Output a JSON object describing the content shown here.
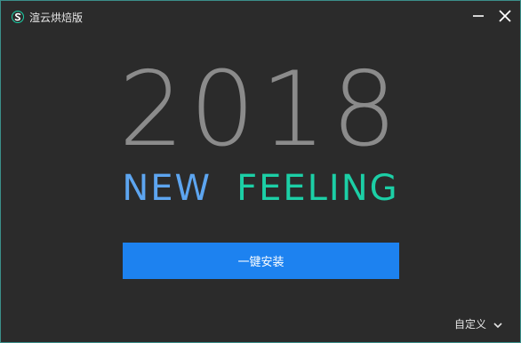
{
  "window": {
    "title": "渲云烘焙版",
    "logo_icon": "s-logo-icon",
    "minimize_icon": "minimize-icon",
    "close_icon": "close-icon",
    "border_color": "#3c8f8a"
  },
  "hero": {
    "year": "2018",
    "tagline_new": "NEW",
    "tagline_feeling": "FEELING",
    "year_color": "#8b8b8b",
    "new_color": "#5da5f0",
    "feeling_color": "#1ccfa6"
  },
  "actions": {
    "install_label": "一键安装",
    "install_color": "#1d82f0",
    "custom_label": "自定义",
    "custom_icon": "chevron-down-icon"
  }
}
